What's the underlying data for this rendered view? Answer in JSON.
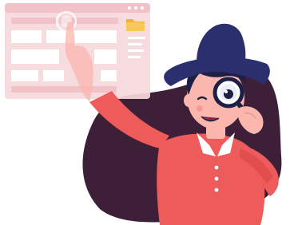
{
  "illustration": {
    "window_icons": [
      "dot-icon",
      "dot-icon",
      "dot-icon",
      "folder-icon"
    ],
    "colors": {
      "window_bg": "#f6d9dc",
      "window_panel": "#f1c3c8",
      "folder": "#f3b22f",
      "blob": "#3d2038",
      "shirt": "#ee5b5b",
      "hat": "#2c2f6e",
      "hat_band": "#e8b73a",
      "skin": "#fbb6ad",
      "hair": "#1e1f47",
      "lens": "#ffffff"
    }
  }
}
